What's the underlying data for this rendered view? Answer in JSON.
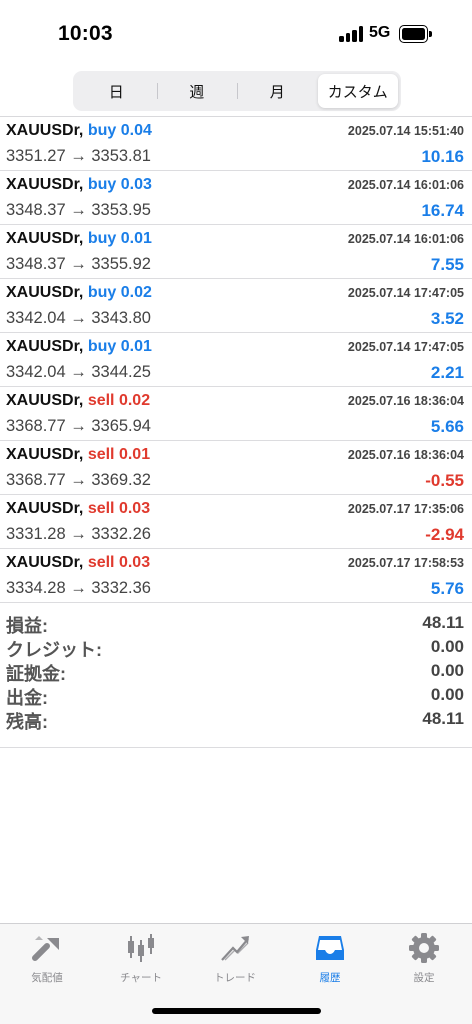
{
  "status": {
    "time": "10:03",
    "network": "5G"
  },
  "period_tabs": [
    {
      "label": "日",
      "active": false
    },
    {
      "label": "週",
      "active": false
    },
    {
      "label": "月",
      "active": false
    },
    {
      "label": "カスタム",
      "active": true
    }
  ],
  "deals": [
    {
      "symbol": "XAUUSDr,",
      "side": "buy",
      "volume": "0.04",
      "time": "2025.07.14 15:51:40",
      "open": "3351.27",
      "close": "3353.81",
      "profit": "10.16"
    },
    {
      "symbol": "XAUUSDr,",
      "side": "buy",
      "volume": "0.03",
      "time": "2025.07.14 16:01:06",
      "open": "3348.37",
      "close": "3353.95",
      "profit": "16.74"
    },
    {
      "symbol": "XAUUSDr,",
      "side": "buy",
      "volume": "0.01",
      "time": "2025.07.14 16:01:06",
      "open": "3348.37",
      "close": "3355.92",
      "profit": "7.55"
    },
    {
      "symbol": "XAUUSDr,",
      "side": "buy",
      "volume": "0.02",
      "time": "2025.07.14 17:47:05",
      "open": "3342.04",
      "close": "3343.80",
      "profit": "3.52"
    },
    {
      "symbol": "XAUUSDr,",
      "side": "buy",
      "volume": "0.01",
      "time": "2025.07.14 17:47:05",
      "open": "3342.04",
      "close": "3344.25",
      "profit": "2.21"
    },
    {
      "symbol": "XAUUSDr,",
      "side": "sell",
      "volume": "0.02",
      "time": "2025.07.16 18:36:04",
      "open": "3368.77",
      "close": "3365.94",
      "profit": "5.66"
    },
    {
      "symbol": "XAUUSDr,",
      "side": "sell",
      "volume": "0.01",
      "time": "2025.07.16 18:36:04",
      "open": "3368.77",
      "close": "3369.32",
      "profit": "-0.55"
    },
    {
      "symbol": "XAUUSDr,",
      "side": "sell",
      "volume": "0.03",
      "time": "2025.07.17 17:35:06",
      "open": "3331.28",
      "close": "3332.26",
      "profit": "-2.94"
    },
    {
      "symbol": "XAUUSDr,",
      "side": "sell",
      "volume": "0.03",
      "time": "2025.07.17 17:58:53",
      "open": "3334.28",
      "close": "3332.36",
      "profit": "5.76"
    }
  ],
  "arrow": "→",
  "summary": [
    {
      "label": "損益:",
      "value": "48.11"
    },
    {
      "label": "クレジット:",
      "value": "0.00"
    },
    {
      "label": "証拠金:",
      "value": "0.00"
    },
    {
      "label": "出金:",
      "value": "0.00"
    },
    {
      "label": "残高:",
      "value": "48.11"
    }
  ],
  "tabbar": [
    {
      "label": "気配値",
      "icon": "quotes-icon",
      "active": false
    },
    {
      "label": "チャート",
      "icon": "chart-icon",
      "active": false
    },
    {
      "label": "トレード",
      "icon": "trade-icon",
      "active": false
    },
    {
      "label": "履歴",
      "icon": "history-icon",
      "active": true
    },
    {
      "label": "設定",
      "icon": "settings-icon",
      "active": false
    }
  ],
  "colors": {
    "buy": "#1a7ee8",
    "sell": "#e03a2e",
    "tab_active": "#1a7ee8",
    "tab_inactive": "#8a8a8e"
  }
}
